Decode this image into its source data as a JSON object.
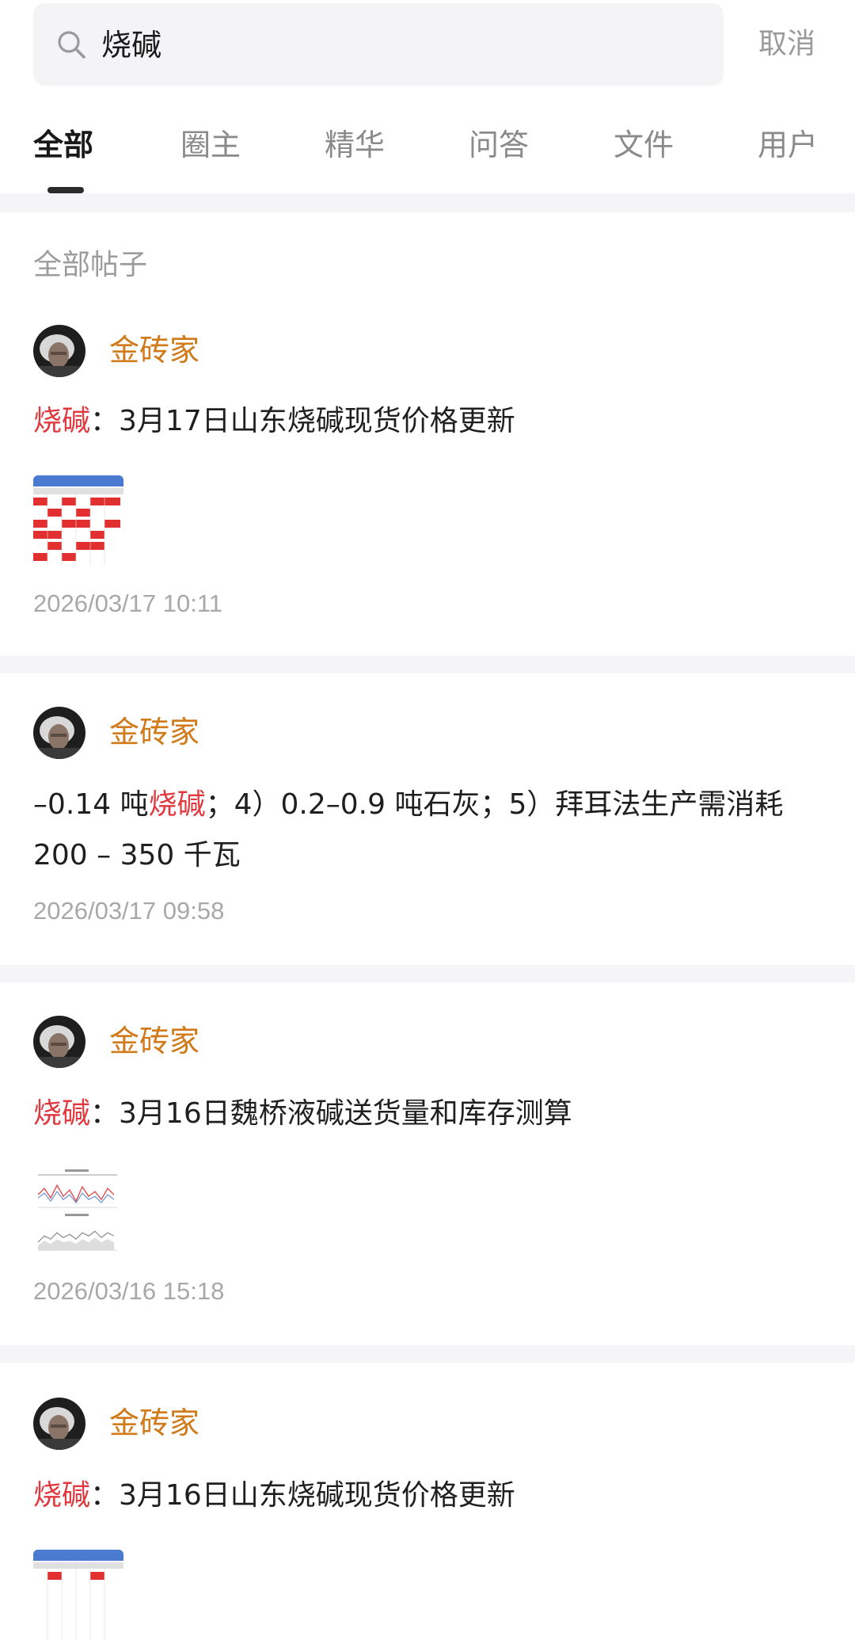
{
  "search": {
    "query": "烧碱",
    "cancel_label": "取消"
  },
  "tabs": [
    {
      "label": "全部",
      "active": true
    },
    {
      "label": "圈主",
      "active": false
    },
    {
      "label": "精华",
      "active": false
    },
    {
      "label": "问答",
      "active": false
    },
    {
      "label": "文件",
      "active": false
    },
    {
      "label": "用户",
      "active": false
    }
  ],
  "section_title": "全部帖子",
  "colors": {
    "author": "#d07a1a",
    "highlight": "#e0383e",
    "timestamp": "#a8a8a8",
    "band": "#f5f5f7"
  },
  "posts": [
    {
      "author": "金砖家",
      "highlight": "烧碱",
      "text": "：3月17日山东烧碱现货价格更新",
      "has_image": true,
      "image_kind": "price-table-thumbnail",
      "time": "2026/03/17 10:11"
    },
    {
      "author": "金砖家",
      "text_before": "–0.14 吨",
      "highlight": "烧碱",
      "text_after": "；4）0.2–0.9 吨石灰；5）拜耳法生产需消耗",
      "text_line2": "200 – 350 千瓦",
      "has_image": false,
      "time": "2026/03/17 09:58"
    },
    {
      "author": "金砖家",
      "highlight": "烧碱",
      "text": "：3月16日魏桥液碱送货量和库存测算",
      "has_image": true,
      "image_kind": "line-chart-thumbnail",
      "time": "2026/03/16 15:18"
    },
    {
      "author": "金砖家",
      "highlight": "烧碱",
      "text": "：3月16日山东烧碱现货价格更新",
      "has_image": true,
      "image_kind": "price-table-thumbnail",
      "time": ""
    }
  ]
}
